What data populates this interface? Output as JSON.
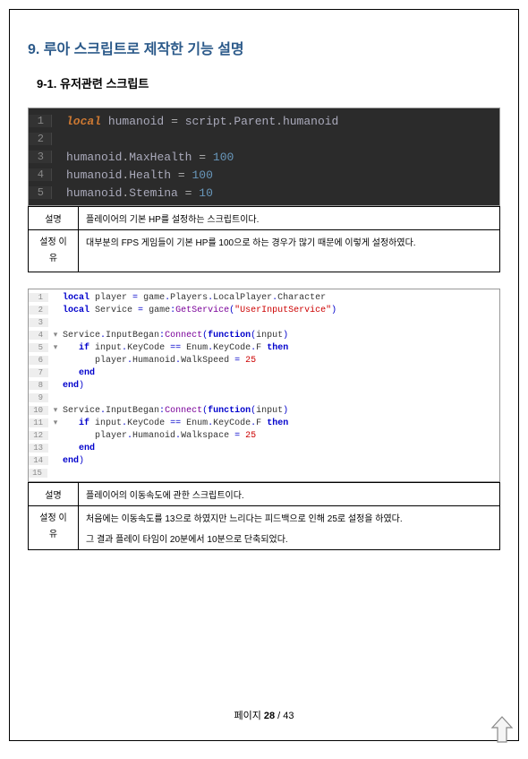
{
  "heading": "9. 루아 스크립트로 제작한 기능 설명",
  "subheading": "9-1. 유저관련 스크립트",
  "code1": {
    "lines": [
      {
        "n": 1,
        "tokens": [
          [
            "kw-local",
            "local"
          ],
          [
            "",
            "  "
          ],
          [
            "ident",
            "humanoid"
          ],
          [
            "",
            " "
          ],
          [
            "eq",
            "="
          ],
          [
            "",
            " "
          ],
          [
            "ident",
            "script"
          ],
          [
            "dot",
            "."
          ],
          [
            "ident",
            "Parent"
          ],
          [
            "dot",
            "."
          ],
          [
            "ident",
            "humanoid"
          ]
        ]
      },
      {
        "n": 2,
        "tokens": []
      },
      {
        "n": 3,
        "tokens": [
          [
            "ident",
            "humanoid"
          ],
          [
            "dot",
            "."
          ],
          [
            "ident",
            "MaxHealth"
          ],
          [
            "",
            " "
          ],
          [
            "eq",
            "="
          ],
          [
            "",
            " "
          ],
          [
            "num",
            "100"
          ]
        ]
      },
      {
        "n": 4,
        "tokens": [
          [
            "ident",
            "humanoid"
          ],
          [
            "dot",
            "."
          ],
          [
            "ident",
            "Health"
          ],
          [
            "",
            " "
          ],
          [
            "eq",
            "="
          ],
          [
            "",
            " "
          ],
          [
            "num",
            "100"
          ]
        ]
      },
      {
        "n": 5,
        "tokens": [
          [
            "ident",
            "humanoid"
          ],
          [
            "dot",
            "."
          ],
          [
            "ident",
            "Stemina"
          ],
          [
            "",
            " "
          ],
          [
            "eq",
            "="
          ],
          [
            "",
            " "
          ],
          [
            "num",
            "10"
          ]
        ]
      }
    ]
  },
  "table1": {
    "desc_label": "설명",
    "desc_body": "플레이어의 기본 HP를 설정하는 스크립트이다.",
    "reason_label": "설정 이유",
    "reason_body": "대부분의 FPS 게임들이 기본 HP를 100으로 하는 경우가 많기 때문에 이렇게 설정하였다."
  },
  "code2": {
    "lines": [
      {
        "n": 1,
        "fold": "",
        "tokens": [
          [
            "l-kw",
            "local"
          ],
          [
            "",
            " "
          ],
          [
            "l-id",
            "player "
          ],
          [
            "l-punct",
            "="
          ],
          [
            "",
            " "
          ],
          [
            "l-id",
            "game"
          ],
          [
            "l-punct",
            "."
          ],
          [
            "l-id",
            "Players"
          ],
          [
            "l-punct",
            "."
          ],
          [
            "l-id",
            "LocalPlayer"
          ],
          [
            "l-punct",
            "."
          ],
          [
            "l-id",
            "Character"
          ]
        ]
      },
      {
        "n": 2,
        "fold": "",
        "tokens": [
          [
            "l-kw",
            "local"
          ],
          [
            "",
            " "
          ],
          [
            "l-id",
            "Service "
          ],
          [
            "l-punct",
            "="
          ],
          [
            "",
            " "
          ],
          [
            "l-id",
            "game"
          ],
          [
            "l-punct",
            ":"
          ],
          [
            "l-fn",
            "GetService"
          ],
          [
            "l-punct",
            "("
          ],
          [
            "l-str",
            "\"UserInputService\""
          ],
          [
            "l-punct",
            ")"
          ]
        ]
      },
      {
        "n": 3,
        "fold": "",
        "tokens": []
      },
      {
        "n": 4,
        "fold": "▾",
        "tokens": [
          [
            "l-id",
            "Service"
          ],
          [
            "l-punct",
            "."
          ],
          [
            "l-id",
            "InputBegan"
          ],
          [
            "l-punct",
            ":"
          ],
          [
            "l-fn",
            "Connect"
          ],
          [
            "l-punct",
            "("
          ],
          [
            "l-kw",
            "function"
          ],
          [
            "l-punct",
            "("
          ],
          [
            "l-id",
            "input"
          ],
          [
            "l-punct",
            ")"
          ]
        ]
      },
      {
        "n": 5,
        "fold": "▾",
        "indent": 1,
        "tokens": [
          [
            "l-kw",
            "if"
          ],
          [
            "",
            " "
          ],
          [
            "l-id",
            "input"
          ],
          [
            "l-punct",
            "."
          ],
          [
            "l-id",
            "KeyCode "
          ],
          [
            "l-punct",
            "=="
          ],
          [
            "",
            " "
          ],
          [
            "l-id",
            "Enum"
          ],
          [
            "l-punct",
            "."
          ],
          [
            "l-id",
            "KeyCode"
          ],
          [
            "l-punct",
            "."
          ],
          [
            "l-id",
            "F "
          ],
          [
            "l-kw",
            "then"
          ]
        ]
      },
      {
        "n": 6,
        "fold": "",
        "indent": 2,
        "tokens": [
          [
            "l-id",
            "player"
          ],
          [
            "l-punct",
            "."
          ],
          [
            "l-id",
            "Humanoid"
          ],
          [
            "l-punct",
            "."
          ],
          [
            "l-id",
            "WalkSpeed "
          ],
          [
            "l-punct",
            "="
          ],
          [
            "",
            " "
          ],
          [
            "l-num",
            "25"
          ]
        ]
      },
      {
        "n": 7,
        "fold": "",
        "indent": 1,
        "tokens": [
          [
            "l-kw",
            "end"
          ]
        ]
      },
      {
        "n": 8,
        "fold": "",
        "tokens": [
          [
            "l-kw",
            "end"
          ],
          [
            "l-punct",
            ")"
          ]
        ]
      },
      {
        "n": 9,
        "fold": "",
        "tokens": []
      },
      {
        "n": 10,
        "fold": "▾",
        "tokens": [
          [
            "l-id",
            "Service"
          ],
          [
            "l-punct",
            "."
          ],
          [
            "l-id",
            "InputBegan"
          ],
          [
            "l-punct",
            ":"
          ],
          [
            "l-fn",
            "Connect"
          ],
          [
            "l-punct",
            "("
          ],
          [
            "l-kw",
            "function"
          ],
          [
            "l-punct",
            "("
          ],
          [
            "l-id",
            "input"
          ],
          [
            "l-punct",
            ")"
          ]
        ]
      },
      {
        "n": 11,
        "fold": "▾",
        "indent": 1,
        "tokens": [
          [
            "l-kw",
            "if"
          ],
          [
            "",
            " "
          ],
          [
            "l-id",
            "input"
          ],
          [
            "l-punct",
            "."
          ],
          [
            "l-id",
            "KeyCode "
          ],
          [
            "l-punct",
            "=="
          ],
          [
            "",
            " "
          ],
          [
            "l-id",
            "Enum"
          ],
          [
            "l-punct",
            "."
          ],
          [
            "l-id",
            "KeyCode"
          ],
          [
            "l-punct",
            "."
          ],
          [
            "l-id",
            "F "
          ],
          [
            "l-kw",
            "then"
          ]
        ]
      },
      {
        "n": 12,
        "fold": "",
        "indent": 2,
        "tokens": [
          [
            "l-id",
            "player"
          ],
          [
            "l-punct",
            "."
          ],
          [
            "l-id",
            "Humanoid"
          ],
          [
            "l-punct",
            "."
          ],
          [
            "l-id",
            "Walkspace "
          ],
          [
            "l-punct",
            "="
          ],
          [
            "",
            " "
          ],
          [
            "l-num",
            "25"
          ]
        ]
      },
      {
        "n": 13,
        "fold": "",
        "indent": 1,
        "tokens": [
          [
            "l-kw",
            "end"
          ]
        ]
      },
      {
        "n": 14,
        "fold": "",
        "tokens": [
          [
            "l-kw",
            "end"
          ],
          [
            "l-punct",
            ")"
          ]
        ]
      },
      {
        "n": 15,
        "fold": "",
        "hl": true,
        "tokens": []
      }
    ]
  },
  "table2": {
    "desc_label": "설명",
    "desc_body": "플레이어의 이동속도에 관한 스크립트이다.",
    "reason_label": "설정 이유",
    "reason_line1": "처음에는 이동속도를 13으로 하였지만 느리다는 피드백으로 인해 25로 설정을 하였다.",
    "reason_line2": "그 결과 플레이 타임이 20분에서 10분으로 단축되었다."
  },
  "footer": {
    "prefix": "페이지 ",
    "current": "28",
    "sep": " / ",
    "total": "43"
  }
}
